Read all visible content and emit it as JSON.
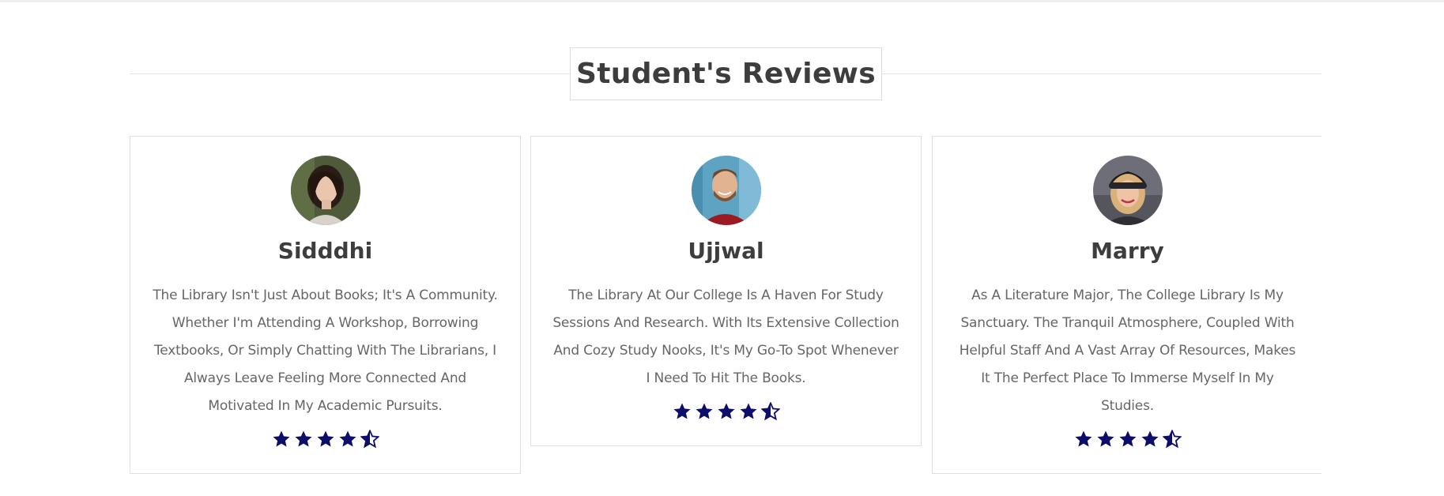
{
  "section": {
    "title": "Student's Reviews"
  },
  "reviews": [
    {
      "name": "Sidddhi",
      "text": "The Library Isn't Just About Books; It's A Community. Whether I'm Attending A Workshop, Borrowing Textbooks, Or Simply Chatting With The Librarians, I Always Leave Feeling More Connected And Motivated In My Academic Pursuits.",
      "rating": 4.5
    },
    {
      "name": "Ujjwal",
      "text": "The Library At Our College Is A Haven For Study Sessions And Research. With Its Extensive Collection And Cozy Study Nooks, It's My Go-To Spot Whenever I Need To Hit The Books.",
      "rating": 4.5
    },
    {
      "name": "Marry",
      "text": "As A Literature Major, The College Library Is My Sanctuary. The Tranquil Atmosphere, Coupled With Helpful Staff And A Vast Array Of Resources, Makes It The Perfect Place To Immerse Myself In My Studies.",
      "rating": 4.5
    }
  ],
  "icons": {
    "star_full": "star-icon",
    "star_half": "star-half-icon"
  },
  "colors": {
    "star": "#0d0d6b",
    "heading": "#3d3d3d",
    "body_text": "#666666",
    "border": "#e0e0e0"
  }
}
